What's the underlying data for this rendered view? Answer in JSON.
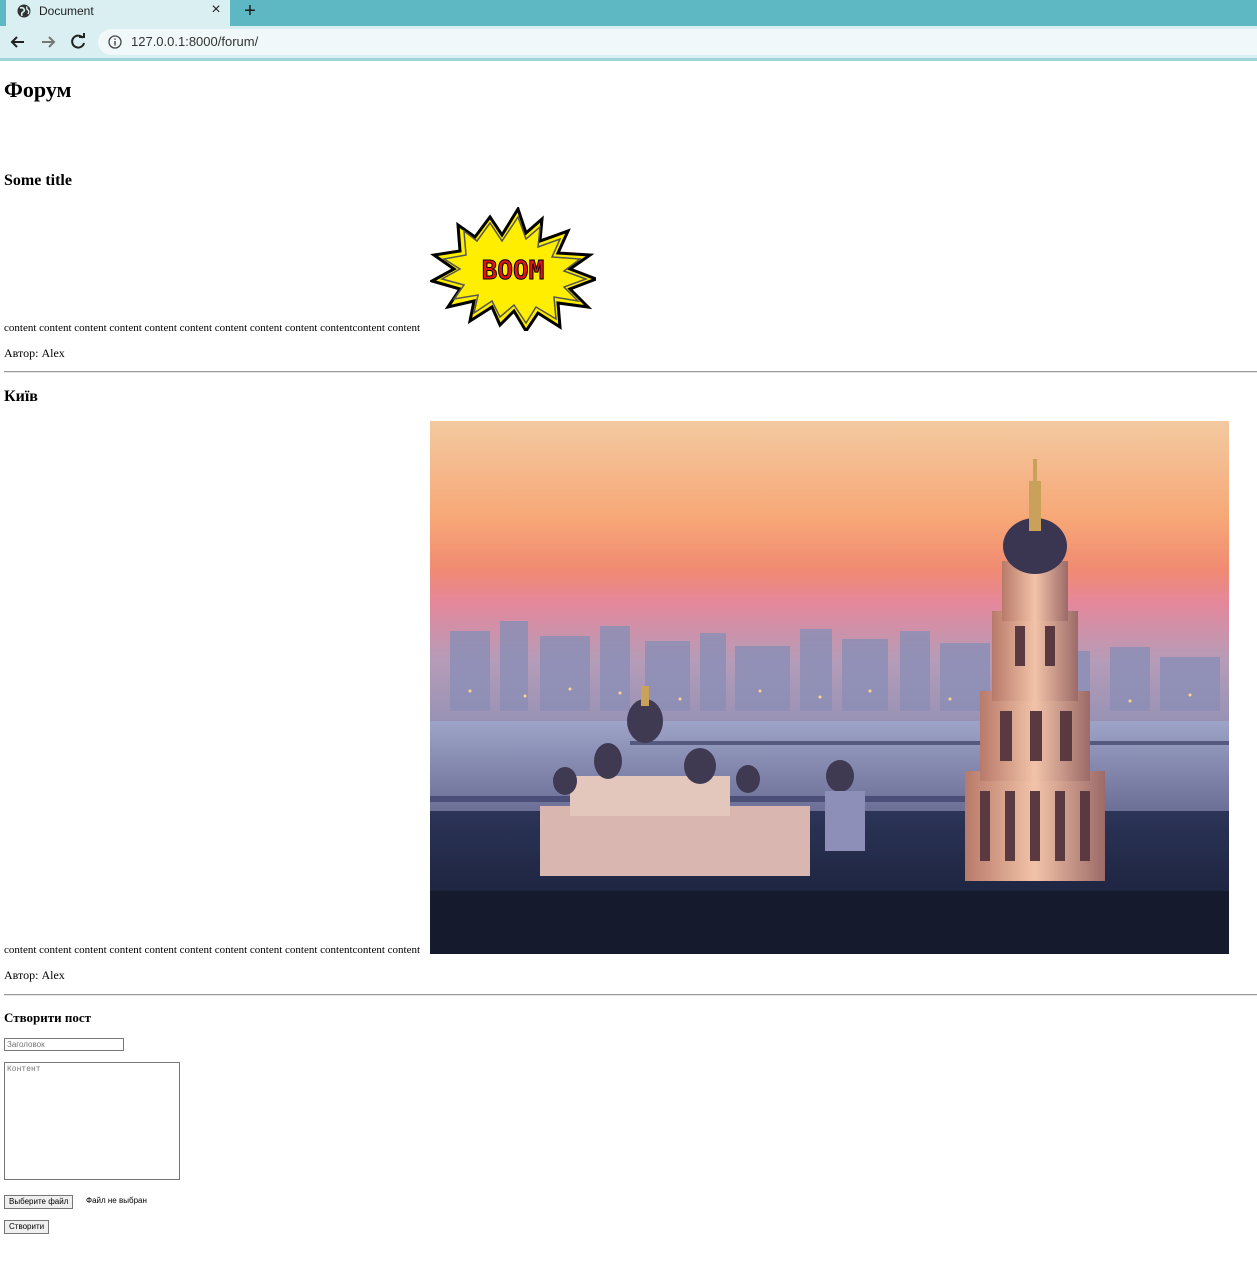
{
  "browser": {
    "tab_title": "Document",
    "tab_close": "×",
    "new_tab": "+",
    "url": "127.0.0.1:8000/forum/"
  },
  "page": {
    "heading": "Форум",
    "posts": [
      {
        "title": "Some title",
        "content": "content content content content content content content content content contentcontent content",
        "author": "Автор: Alex",
        "image": "boom-comic-sticker",
        "image_text": "BOOM"
      },
      {
        "title": "Київ",
        "content": "content content content content content content content content content contentcontent content",
        "author": "Автор: Alex",
        "image": "kyiv-pechersk-lavra-sunset-photo"
      }
    ],
    "form": {
      "title": "Створити пост",
      "title_placeholder": "Заголовок",
      "content_placeholder": "Контент",
      "file_button": "Выберите файл",
      "file_status": "Файл не выбран",
      "submit": "Створити"
    }
  },
  "colors": {
    "tabbar": "#5db8c3",
    "toolbar": "#d9eff2",
    "boom_fill": "#ffee00",
    "boom_text": "#e0141e"
  }
}
